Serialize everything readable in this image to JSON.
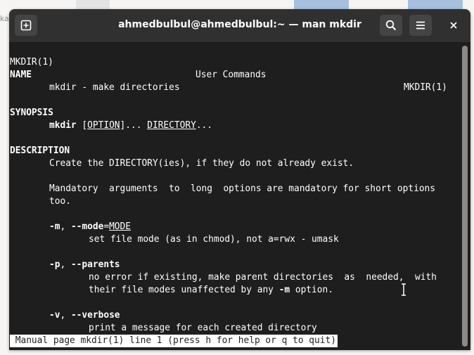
{
  "window": {
    "title": "ahmedbulbul@ahmedbulbul:~ — man mkdir"
  },
  "headerbar": {
    "new_tab_icon": "plus-square-icon",
    "search_icon": "search-icon",
    "menu_icon": "hamburger-menu-icon",
    "close_icon": "close-icon"
  },
  "desktop": {
    "left_fragment": "ka"
  },
  "man": {
    "header_left": "MKDIR(1)",
    "header_center": "User Commands",
    "header_right": "MKDIR(1)",
    "name_heading": "NAME",
    "name_text": "mkdir - make directories",
    "synopsis_heading": "SYNOPSIS",
    "syn_cmd": "mkdir",
    "syn_sp": " ",
    "syn_option": "OPTION",
    "syn_close": "]... ",
    "syn_open": "[",
    "syn_directory": "DIRECTORY",
    "syn_end": "...",
    "description_heading": "DESCRIPTION",
    "desc_line1": "Create the DIRECTORY(ies), if they do not already exist.",
    "desc_line2": "Mandatory  arguments  to  long  options are mandatory for short options",
    "desc_line3": "too.",
    "opt_m_flag": "-m",
    "opt_m_sep": ", ",
    "opt_m_long": "--mode",
    "opt_m_eq": "=",
    "opt_m_arg": "MODE",
    "opt_m_desc": "set file mode (as in chmod), not a=rwx - umask",
    "opt_p_flag": "-p",
    "opt_p_sep": ", ",
    "opt_p_long": "--parents",
    "opt_p_desc1": "no error if existing, make parent directories  as  needed,  with",
    "opt_p_desc2_pre": "their file modes unaffected by any ",
    "opt_p_desc2_flag": "-m",
    "opt_p_desc2_post": " option.",
    "opt_v_flag": "-v",
    "opt_v_sep": ", ",
    "opt_v_long": "--verbose",
    "opt_v_desc": "print a message for each created directory"
  },
  "status": {
    "text": " Manual page mkdir(1) line 1 (press h for help or q to quit)"
  },
  "colors": {
    "terminal_bg": "#1e1e1e",
    "headerbar_bg": "#303030",
    "text": "#ffffff"
  }
}
